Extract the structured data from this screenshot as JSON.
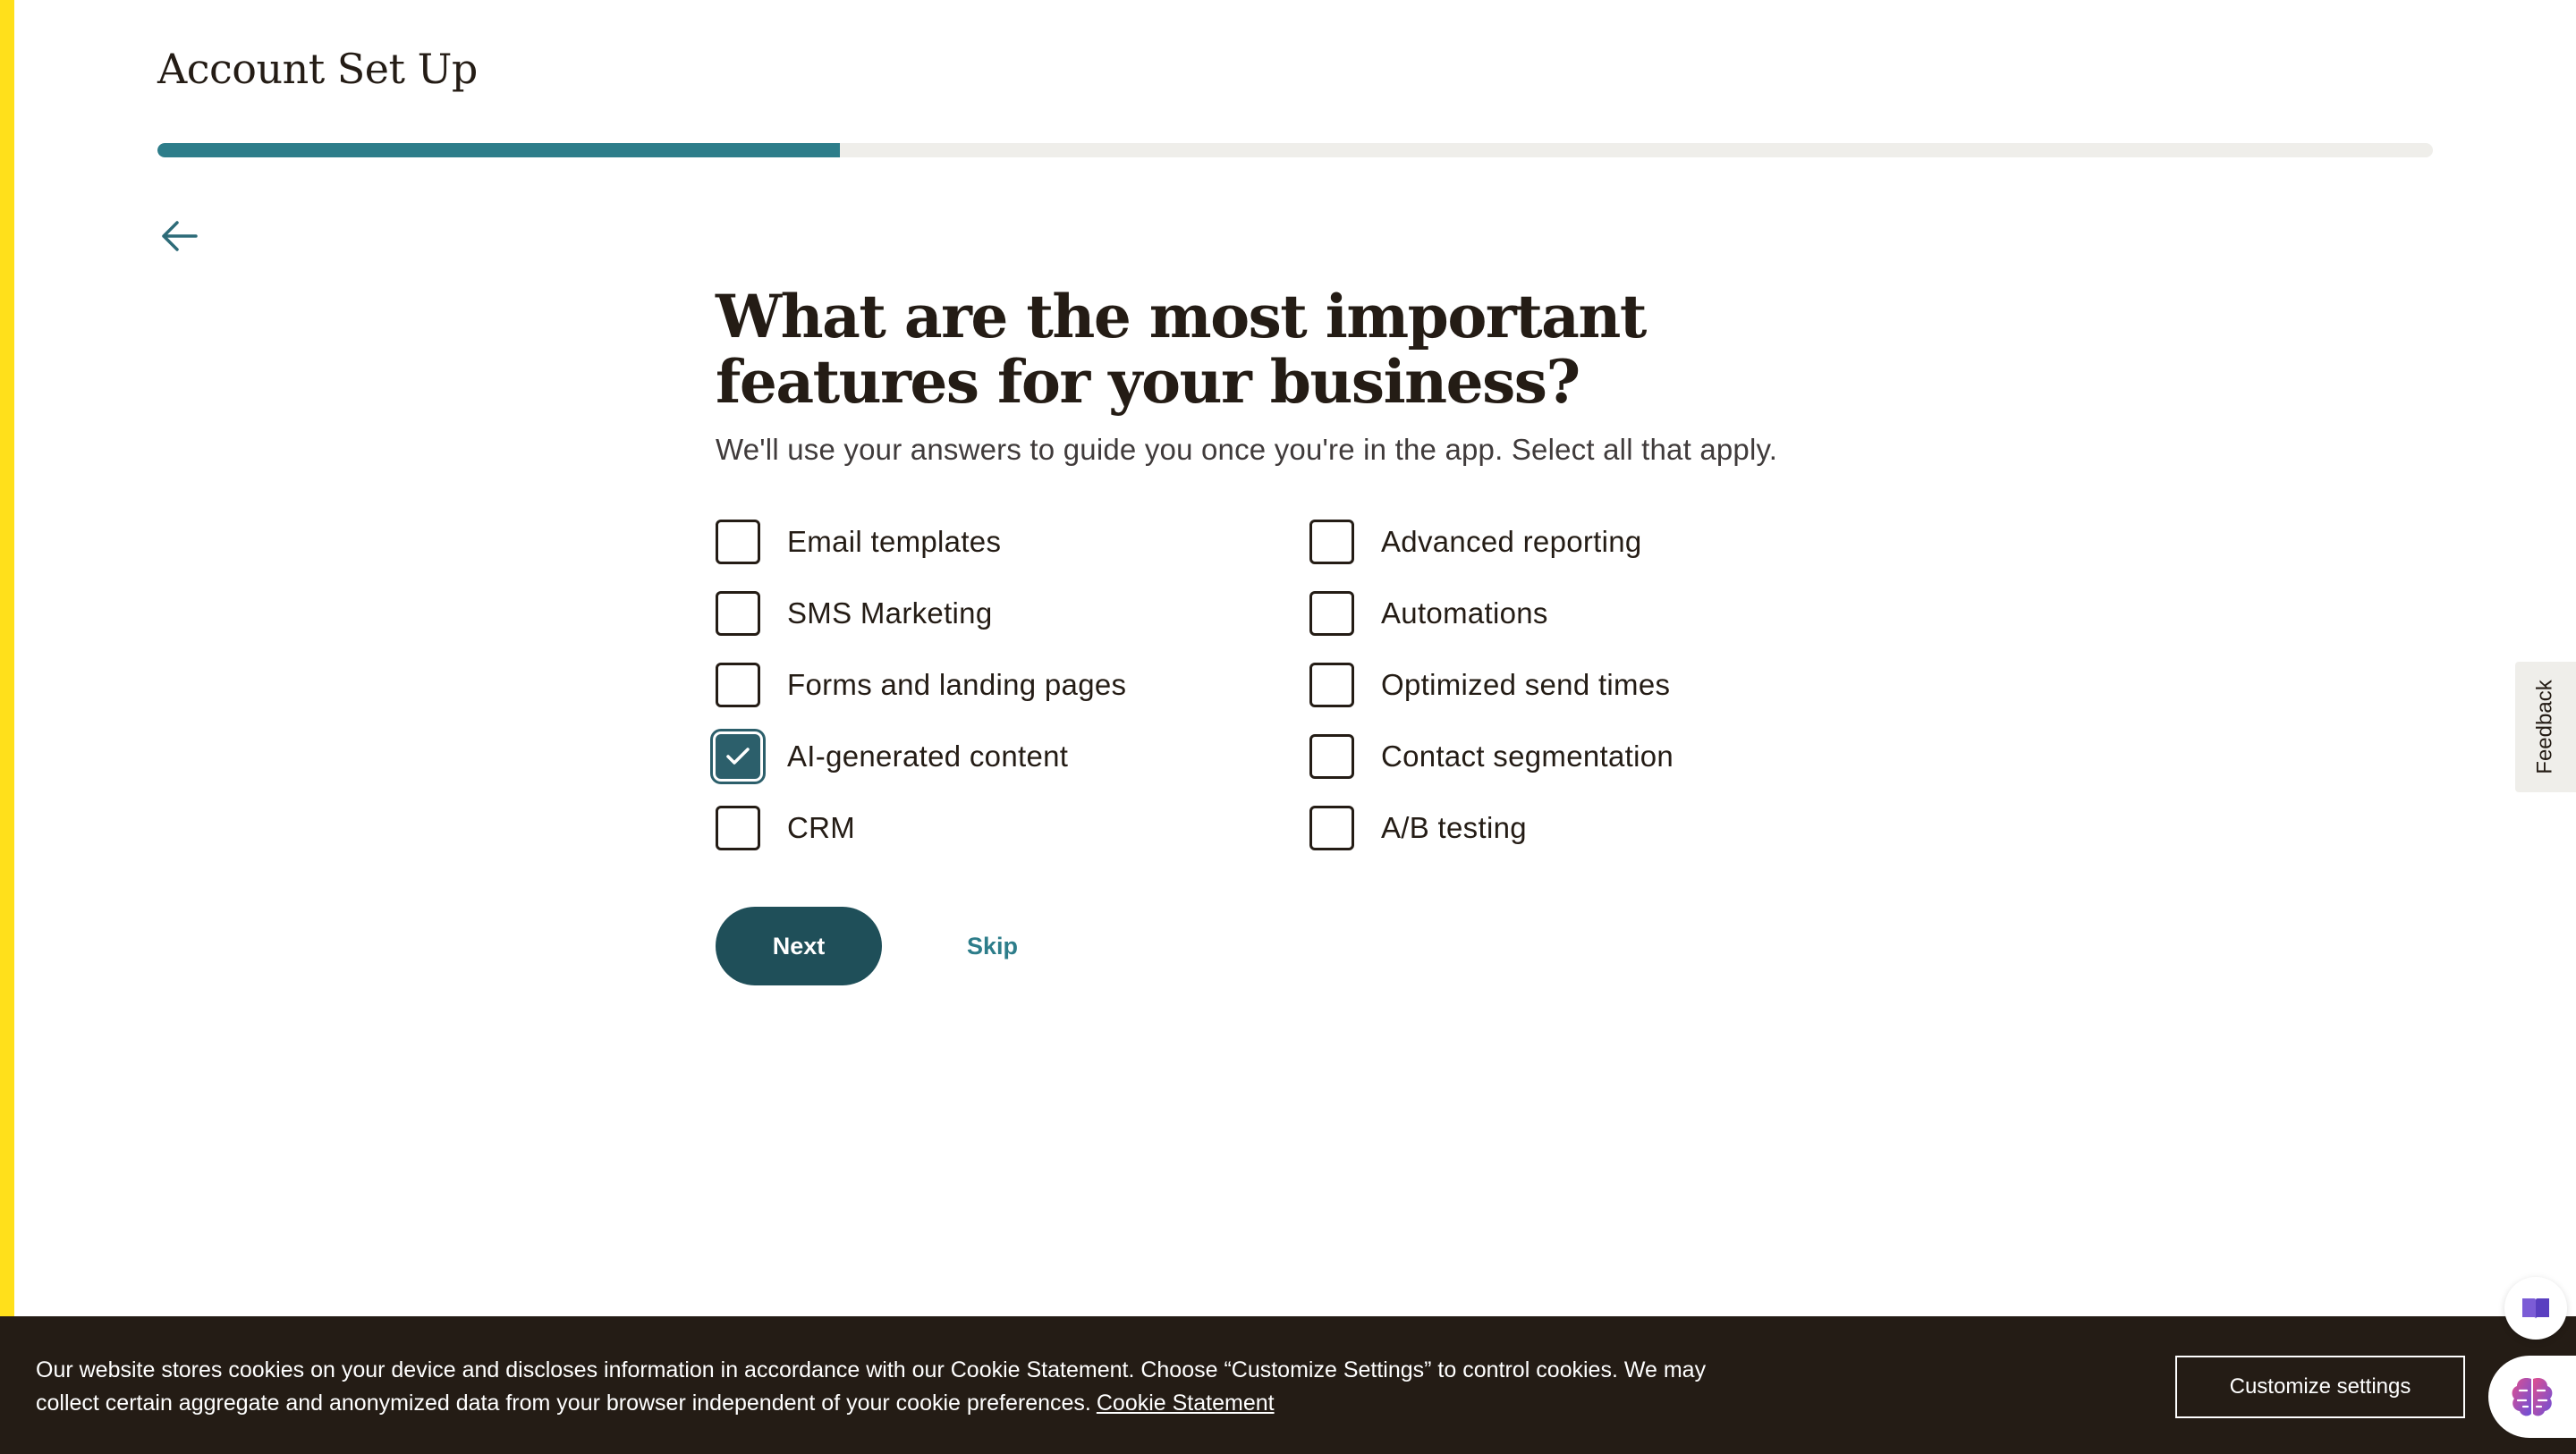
{
  "header": {
    "title": "Account Set Up",
    "progress_percent": 30
  },
  "back": {
    "icon": "arrow-left-icon"
  },
  "question": {
    "title": "What are the most important features for your business?",
    "subtitle": "We'll use your answers to guide you once you're in the app. Select all that apply."
  },
  "options": [
    {
      "label": "Email templates",
      "checked": false
    },
    {
      "label": "Advanced reporting",
      "checked": false
    },
    {
      "label": "SMS Marketing",
      "checked": false
    },
    {
      "label": "Automations",
      "checked": false
    },
    {
      "label": "Forms and landing pages",
      "checked": false
    },
    {
      "label": "Optimized send times",
      "checked": false
    },
    {
      "label": "AI-generated content",
      "checked": true
    },
    {
      "label": "Contact segmentation",
      "checked": false
    },
    {
      "label": "CRM",
      "checked": false
    },
    {
      "label": "A/B testing",
      "checked": false
    }
  ],
  "actions": {
    "next_label": "Next",
    "skip_label": "Skip"
  },
  "feedback": {
    "label": "Feedback"
  },
  "cookie": {
    "text": "Our website stores cookies on your device and discloses information in accordance with our Cookie Statement. Choose “Customize Settings” to control cookies. We may collect certain aggregate and anonymized data from your browser independent of your cookie preferences.",
    "link_label": "Cookie Statement",
    "customize_label": "Customize settings"
  },
  "colors": {
    "accent_stripe": "#ffe01b",
    "progress_fill": "#2d7d8a",
    "primary_button": "#1f4f59",
    "checked_box": "#2c5f6b",
    "cookie_banner": "#241c15"
  }
}
